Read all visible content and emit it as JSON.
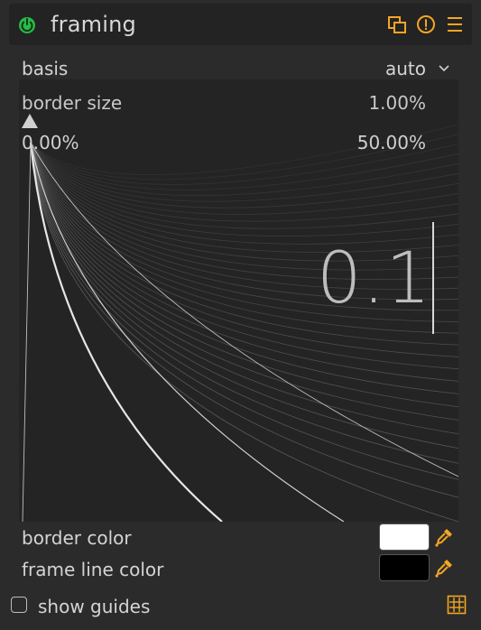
{
  "header": {
    "title": "framing",
    "accent_color": "#f5a623",
    "power_color": "#2db84a",
    "icons": [
      "power-icon",
      "presets-icon",
      "reset-icon",
      "menu-icon"
    ]
  },
  "basis": {
    "label": "basis",
    "value": "auto"
  },
  "popup": {
    "label": "border size",
    "value": "1.00%",
    "min_label": "0.00%",
    "max_label": "50.00%",
    "typed_value": "0.1"
  },
  "border_color": {
    "label": "border color",
    "swatch_color": "#ffffff"
  },
  "frame_line_color": {
    "label": "frame line color",
    "swatch_color": "#000000"
  },
  "show_guides": {
    "label": "show guides",
    "checked": false
  }
}
